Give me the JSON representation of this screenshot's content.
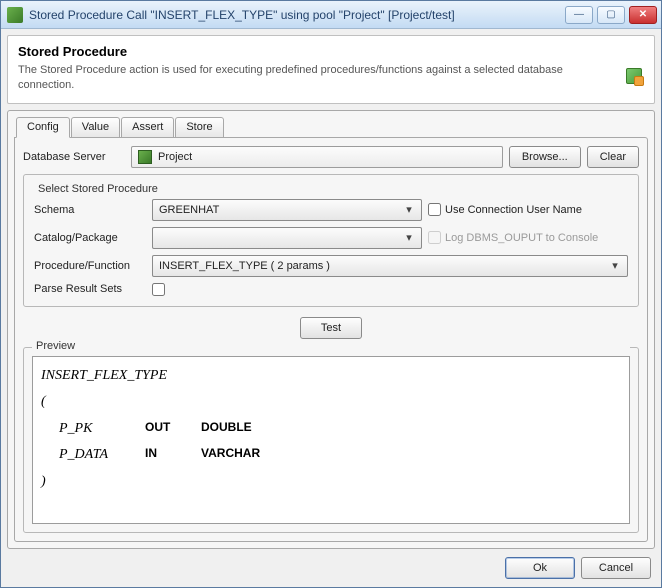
{
  "window": {
    "title": "Stored Procedure Call \"INSERT_FLEX_TYPE\" using pool \"Project\" [Project/test]"
  },
  "header": {
    "title": "Stored Procedure",
    "description": "The Stored Procedure action is used for executing predefined procedures/functions against a selected database connection."
  },
  "tabs": [
    "Config",
    "Value",
    "Assert",
    "Store"
  ],
  "db": {
    "label": "Database Server",
    "value": "Project",
    "browse": "Browse...",
    "clear": "Clear"
  },
  "select_group": {
    "legend": "Select Stored Procedure",
    "schema_label": "Schema",
    "schema_value": "GREENHAT",
    "use_conn_label": "Use Connection User Name",
    "catalog_label": "Catalog/Package",
    "catalog_value": "",
    "log_dbms_label": "Log DBMS_OUPUT to Console",
    "proc_label": "Procedure/Function",
    "proc_value": "INSERT_FLEX_TYPE ( 2 params )",
    "parse_label": "Parse Result Sets"
  },
  "test_button": "Test",
  "preview": {
    "legend": "Preview",
    "proc_name": "INSERT_FLEX_TYPE",
    "open": "(",
    "close": ")",
    "params": [
      {
        "name": "P_PK",
        "dir": "OUT",
        "type": "DOUBLE"
      },
      {
        "name": "P_DATA",
        "dir": "IN",
        "type": "VARCHAR"
      }
    ]
  },
  "footer": {
    "ok": "Ok",
    "cancel": "Cancel"
  }
}
